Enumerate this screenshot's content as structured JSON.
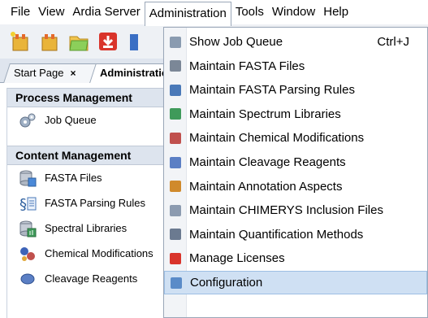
{
  "menubar": {
    "items": [
      "File",
      "View",
      "Ardia Server",
      "Administration",
      "Tools",
      "Window",
      "Help"
    ],
    "open_item": "Administration"
  },
  "tabs": [
    {
      "label": "Start Page",
      "close": "×"
    },
    {
      "label": "Administration"
    }
  ],
  "panel": {
    "process_header": "Process Management",
    "process_items": [
      {
        "label": "Job Queue",
        "icon": "gears-icon"
      }
    ],
    "content_header": "Content Management",
    "content_items": [
      {
        "label": "FASTA Files",
        "icon": "database-icon"
      },
      {
        "label": "FASTA Parsing Rules",
        "icon": "parsing-rules-icon"
      },
      {
        "label": "Spectral Libraries",
        "icon": "spectral-library-icon"
      },
      {
        "label": "Chemical Modifications",
        "icon": "molecule-icon"
      },
      {
        "label": "Cleavage Reagents",
        "icon": "cleavage-icon"
      }
    ]
  },
  "dropdown": {
    "items": [
      {
        "label": "Show Job Queue",
        "shortcut": "Ctrl+J",
        "icon": "gears-icon",
        "color": "#8a9bb0"
      },
      {
        "label": "Maintain FASTA Files",
        "icon": "database-icon",
        "color": "#7b8797"
      },
      {
        "label": "Maintain FASTA Parsing Rules",
        "icon": "parsing-rules-icon",
        "color": "#4a79b8"
      },
      {
        "label": "Maintain Spectrum Libraries",
        "icon": "spectral-library-icon",
        "color": "#3f9a5a"
      },
      {
        "label": "Maintain Chemical Modifications",
        "icon": "molecule-icon",
        "color": "#c0504d"
      },
      {
        "label": "Maintain Cleavage Reagents",
        "icon": "cleavage-icon",
        "color": "#5b7fc4"
      },
      {
        "label": "Maintain Annotation Aspects",
        "icon": "annotation-icon",
        "color": "#d08a2c"
      },
      {
        "label": "Maintain CHIMERYS Inclusion Files",
        "icon": "chimerys-icon",
        "color": "#8c9bb0"
      },
      {
        "label": "Maintain Quantification Methods",
        "icon": "quantification-icon",
        "color": "#6b7a90"
      },
      {
        "label": "Manage Licenses",
        "icon": "license-icon",
        "color": "#d9342b"
      },
      {
        "label": "Configuration",
        "icon": "configuration-icon",
        "color": "#5a8bc8",
        "highlighted": true
      }
    ]
  },
  "colors": {
    "toolbar_bg": "#eef1f5",
    "menu_highlight": "#cfe0f3",
    "panel_header_bg": "#dde4ee"
  }
}
